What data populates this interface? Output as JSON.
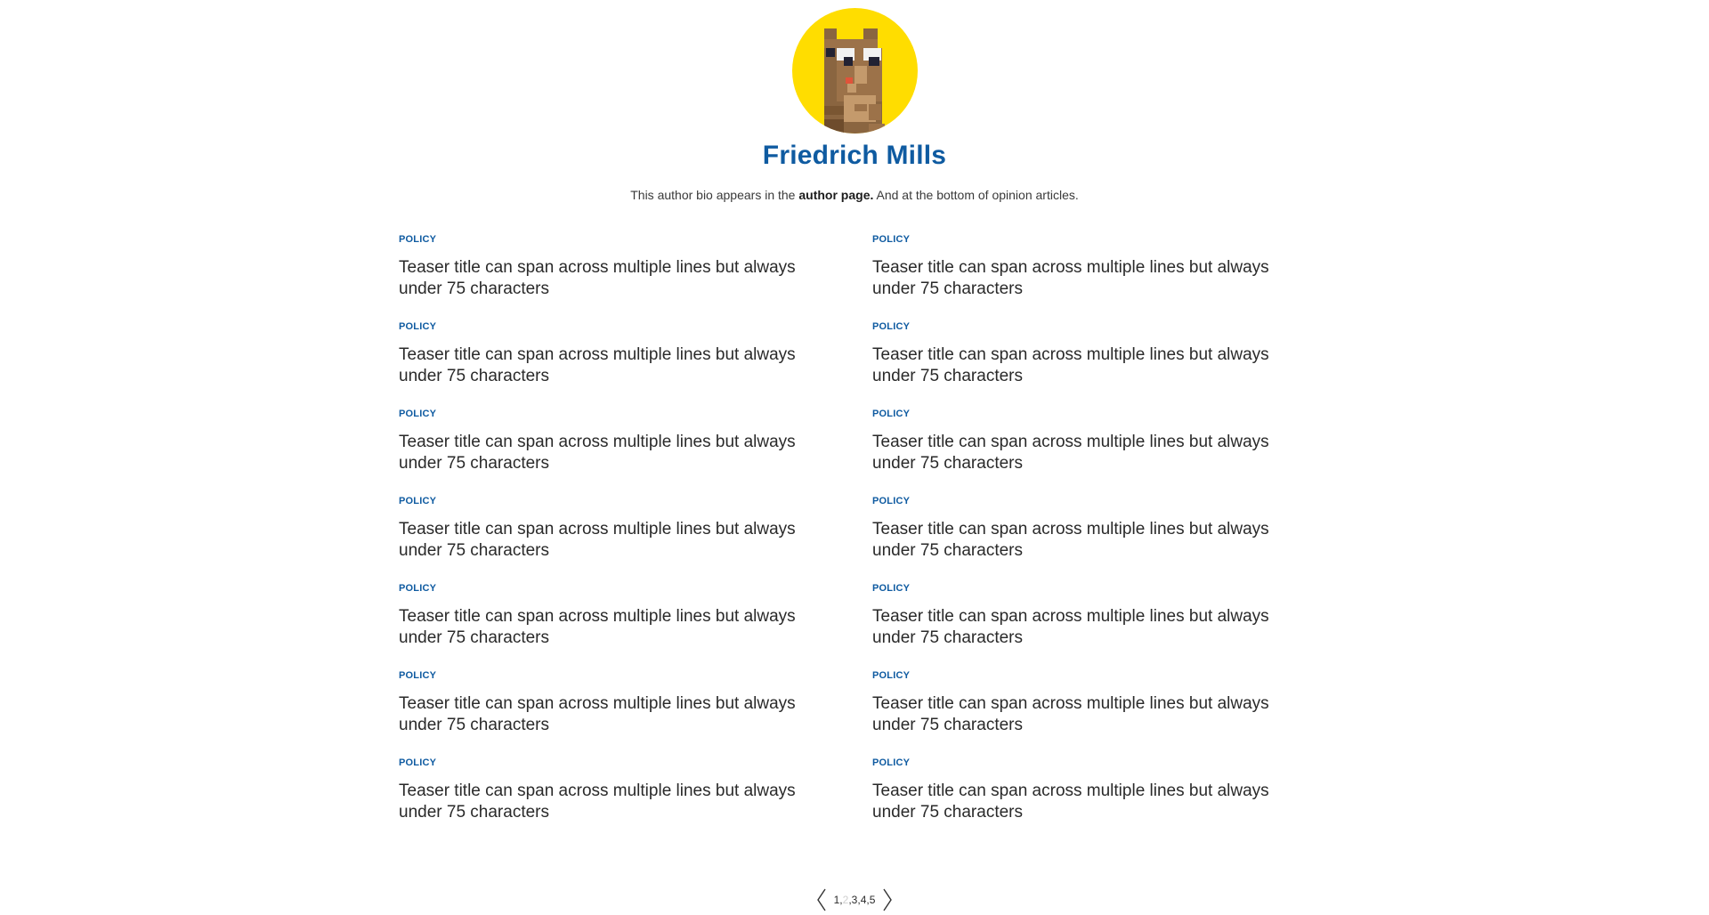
{
  "author": {
    "name": "Friedrich Mills",
    "bio_before": "This author bio appears in the ",
    "bio_link": "author page.",
    "bio_after": " And at the bottom of opinion articles.",
    "avatar_bg": "#ffdd00"
  },
  "teasers": [
    {
      "category": "POLICY",
      "title": "Teaser title can span across multiple lines but always under 75 characters"
    },
    {
      "category": "POLICY",
      "title": "Teaser title can span across multiple lines but always under 75 characters"
    },
    {
      "category": "POLICY",
      "title": "Teaser title can span across multiple lines but always under 75 characters"
    },
    {
      "category": "POLICY",
      "title": "Teaser title can span across multiple lines but always under 75 characters"
    },
    {
      "category": "POLICY",
      "title": "Teaser title can span across multiple lines but always under 75 characters"
    },
    {
      "category": "POLICY",
      "title": "Teaser title can span across multiple lines but always under 75 characters"
    },
    {
      "category": "POLICY",
      "title": "Teaser title can span across multiple lines but always under 75 characters"
    },
    {
      "category": "POLICY",
      "title": "Teaser title can span across multiple lines but always under 75 characters"
    },
    {
      "category": "POLICY",
      "title": "Teaser title can span across multiple lines but always under 75 characters"
    },
    {
      "category": "POLICY",
      "title": "Teaser title can span across multiple lines but always under 75 characters"
    },
    {
      "category": "POLICY",
      "title": "Teaser title can span across multiple lines but always under 75 characters"
    },
    {
      "category": "POLICY",
      "title": "Teaser title can span across multiple lines but always under 75 characters"
    },
    {
      "category": "POLICY",
      "title": "Teaser title can span across multiple lines but always under 75 characters"
    },
    {
      "category": "POLICY",
      "title": "Teaser title can span across multiple lines but always under 75 characters"
    }
  ],
  "pagination": {
    "pages": [
      "1",
      "2",
      "3",
      "4",
      "5"
    ],
    "current": "2",
    "separator": ",",
    "prev_icon": "chevron-left-icon",
    "next_icon": "chevron-right-icon"
  },
  "colors": {
    "accent": "#0f5ba1",
    "text": "#2a2a2a"
  }
}
